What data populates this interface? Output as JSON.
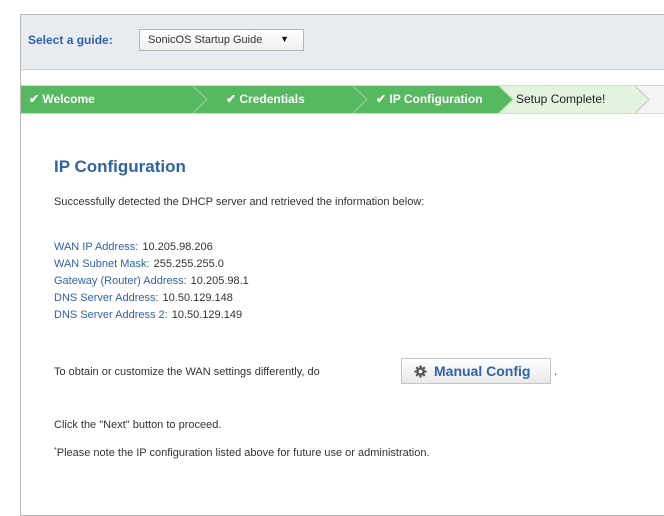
{
  "guide": {
    "label": "Select a guide:",
    "selected": "SonicOS Startup Guide",
    "arrow": "▼"
  },
  "steps": [
    {
      "label": "✔ Welcome",
      "state": "done"
    },
    {
      "label": "✔ Credentials",
      "state": "done"
    },
    {
      "label": "✔ IP Configuration",
      "state": "done"
    },
    {
      "label": "Setup Complete!",
      "state": "active"
    }
  ],
  "main": {
    "title": "IP Configuration",
    "intro": "Successfully detected the DHCP server and retrieved the information below:",
    "info": [
      {
        "key": "WAN IP Address:",
        "value": "10.205.98.206"
      },
      {
        "key": "WAN Subnet Mask:",
        "value": "255.255.255.0"
      },
      {
        "key": "Gateway (Router) Address:",
        "value": "10.205.98.1"
      },
      {
        "key": "DNS Server Address:",
        "value": "10.50.129.148"
      },
      {
        "key": "DNS Server Address 2:",
        "value": "10.50.129.149"
      }
    ],
    "customize_text": "To obtain or customize the WAN settings differently, do",
    "manual_config_label": "Manual Config",
    "period": ".",
    "next_text": "Click the \"Next\" button to proceed.",
    "note_marker": "*",
    "note_text": "Please note the IP configuration listed above for future use or administration."
  },
  "colors": {
    "accent": "#2f63a8",
    "step_done": "#56b85f",
    "step_active": "#e4f2e0"
  },
  "icons": {
    "manual_config": "gear-icon",
    "dropdown": "caret-down-icon"
  }
}
